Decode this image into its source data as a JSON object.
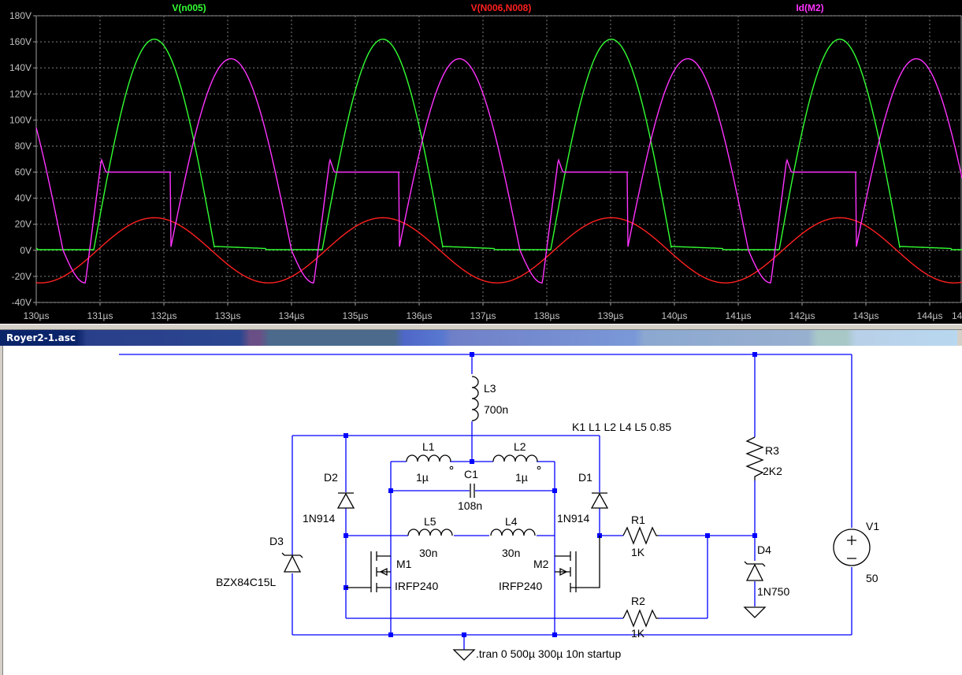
{
  "window": {
    "title": "Royer2-1.asc"
  },
  "traces": [
    {
      "label": "V(n005)",
      "color": "#33ff33"
    },
    {
      "label": "V(N006,N008)",
      "color": "#ff2020"
    },
    {
      "label": "Id(M2)",
      "color": "#ff33ff"
    }
  ],
  "chart_data": {
    "type": "line",
    "xlim": [
      130,
      145
    ],
    "ylim": [
      -40,
      180
    ],
    "x_ticks": [
      "130µs",
      "131µs",
      "132µs",
      "133µs",
      "134µs",
      "135µs",
      "136µs",
      "137µs",
      "138µs",
      "139µs",
      "140µs",
      "141µs",
      "142µs",
      "143µs",
      "144µs"
    ],
    "y_ticks": [
      "180V",
      "160V",
      "140V",
      "120V",
      "100V",
      "80V",
      "60V",
      "40V",
      "20V",
      "0V",
      "-20V",
      "-40V"
    ],
    "grid": true,
    "series": [
      {
        "name": "V(n005)",
        "color": "#33ff33",
        "period": 3.58,
        "peak": 162,
        "peak_time": 131.85
      },
      {
        "name": "V(N006,N008)",
        "color": "#ff2020",
        "period": 3.58,
        "amplitude": 25,
        "peak_time": 131.85
      },
      {
        "name": "Id(M2)",
        "color": "#ff33ff",
        "period": 3.58,
        "peak": 147,
        "plateau": 60,
        "min": -25
      }
    ]
  },
  "schematic": {
    "components": [
      {
        "id": "L3",
        "ref": "L3",
        "value": "700n"
      },
      {
        "id": "L1",
        "ref": "L1",
        "value": "1µ"
      },
      {
        "id": "L2",
        "ref": "L2",
        "value": "1µ"
      },
      {
        "id": "C1",
        "ref": "C1",
        "value": "108n"
      },
      {
        "id": "L5",
        "ref": "L5",
        "value": "30n"
      },
      {
        "id": "L4",
        "ref": "L4",
        "value": "30n"
      },
      {
        "id": "D1",
        "ref": "D1",
        "value": "1N914"
      },
      {
        "id": "D2",
        "ref": "D2",
        "value": "1N914"
      },
      {
        "id": "D3",
        "ref": "D3",
        "value": "BZX84C15L"
      },
      {
        "id": "D4",
        "ref": "D4",
        "value": "1N750"
      },
      {
        "id": "M1",
        "ref": "M1",
        "value": "IRFP240"
      },
      {
        "id": "M2",
        "ref": "M2",
        "value": "IRFP240"
      },
      {
        "id": "R1",
        "ref": "R1",
        "value": "1K"
      },
      {
        "id": "R2",
        "ref": "R2",
        "value": "1K"
      },
      {
        "id": "R3",
        "ref": "R3",
        "value": "2K2"
      },
      {
        "id": "V1",
        "ref": "V1",
        "value": "50"
      }
    ],
    "directives": {
      "coupling": "K1 L1 L2 L4 L5 0.85",
      "tran": ".tran 0 500µ 300µ 10n startup"
    }
  }
}
